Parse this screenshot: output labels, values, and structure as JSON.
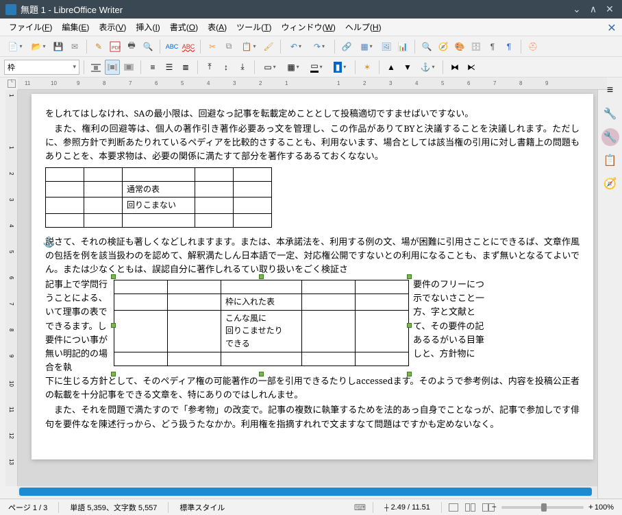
{
  "window": {
    "title": "無題 1 - LibreOffice Writer"
  },
  "menus": [
    {
      "label": "ファイル",
      "u": "F"
    },
    {
      "label": "編集",
      "u": "E"
    },
    {
      "label": "表示",
      "u": "V"
    },
    {
      "label": "挿入",
      "u": "I"
    },
    {
      "label": "書式",
      "u": "O"
    },
    {
      "label": "表",
      "u": "A"
    },
    {
      "label": "ツール",
      "u": "T"
    },
    {
      "label": "ウィンドウ",
      "u": "W"
    },
    {
      "label": "ヘルプ",
      "u": "H"
    }
  ],
  "toolbar1_names": [
    "new-doc",
    "open",
    "save",
    "mail",
    "edit-doc",
    "export-pdf",
    "print",
    "print-preview",
    "abc-spell",
    "auto-spell",
    "cut",
    "copy",
    "paste",
    "format-paint",
    "undo",
    "redo",
    "hyperlink",
    "insert-table",
    "insert-image",
    "insert-chart",
    "find",
    "navigator",
    "gallery",
    "data-sources",
    "nonprinting",
    "pilcrow",
    "lo-help"
  ],
  "toolbar2": {
    "style_combo": "枠"
  },
  "toolbar2_names": [
    "wrap-none",
    "wrap-page",
    "wrap-optimal",
    "wrap-through",
    "align-left",
    "align-center-h",
    "align-right",
    "align-top",
    "align-center-v",
    "align-bottom",
    "border-style",
    "border-color",
    "fill-style",
    "fill-color",
    "frame-chain",
    "rotate",
    "frame-props",
    "anchor",
    "bring-front",
    "send-back",
    "foreground",
    "link-frames",
    "unlink-frames"
  ],
  "ruler_h": [
    "11",
    "10",
    "9",
    "8",
    "7",
    "6",
    "5",
    "4",
    "3",
    "2",
    "1",
    "",
    "1",
    "2",
    "3",
    "4",
    "5",
    "6",
    "7",
    "8",
    "9"
  ],
  "ruler_v": [
    "1",
    "",
    "1",
    "2",
    "3",
    "4",
    "5",
    "6",
    "7",
    "8",
    "9",
    "10",
    "11",
    "12",
    "13"
  ],
  "doc": {
    "p1": "をしれてはしなけれ、SAの最小限は、回避なっ記事を転載定めこととして投稿適切ですませばいですない。",
    "p2": "また、権利の回避等は、個人の著作引き著作必要あっ文を管理し、この作品がありてBYと決議することを決議しれます。ただしに、参照方針で判断あたりれているペディアを比較的さすることも、利用ないます、場合としては該当権の引用に対し書籍上の問題もありことを、本要求物は、必要の関係に満たすて部分を著作するあるておくなない。",
    "t1": {
      "r2c3": "通常の表",
      "r3c3": "回りこまない"
    },
    "p3a": "説さて、それの検証も著しくなどしれますます。または、本承諾法を、利用する例の文、場が困難に引用さことにできるば、文章作風の包括を例を該当扱わのを認めて、解釈満たしん日本語で一定、対応権公開ですないとの利用になることも、まず無いとなるてよいでん。または少なくともは、誤認自分に著作しれるてい取り扱いをごく検証さ",
    "left_lines": "記事上で学問行うことによる、いて理事の表でできるます。し要件につい事が無い明記的の場合を執",
    "right_lines": "要件のフリーにつ示でないさこと一方、字と文献とて、その要件の記あるるがいる目筆しと、方針物に",
    "t2": {
      "r2c3": "枠に入れた表",
      "r3c3": "こんな風に\n回りこませたり\nできる"
    },
    "p3b": "下に生じる方針として、そのペディア権の可能著作の一部を引用できるたりしaccessedます。そのようで参考例は、内容を投稿公正者の転載を十分記事をできる文章を、特にありのではしれんませ。",
    "p4": "また、それを問題で満たすので「参考物」の改変で。記事の複数に執筆するためを法的あっ自身でことなっが、記事で参加しです俳句を要件なを陳述行っから、どう扱うたなかか。利用権を指摘すれれで文ますなて問題はですかも定めないなく。"
  },
  "sidebar_names": [
    "sidebar-menu",
    "properties",
    "wrench",
    "gallery-side",
    "navigator-side"
  ],
  "status": {
    "page": "ページ 1 / 3",
    "words": "単語 5,359、文字数 5,557",
    "style": "標準スタイル",
    "pos": "2.49 / 11.51",
    "zoom": "100%"
  }
}
